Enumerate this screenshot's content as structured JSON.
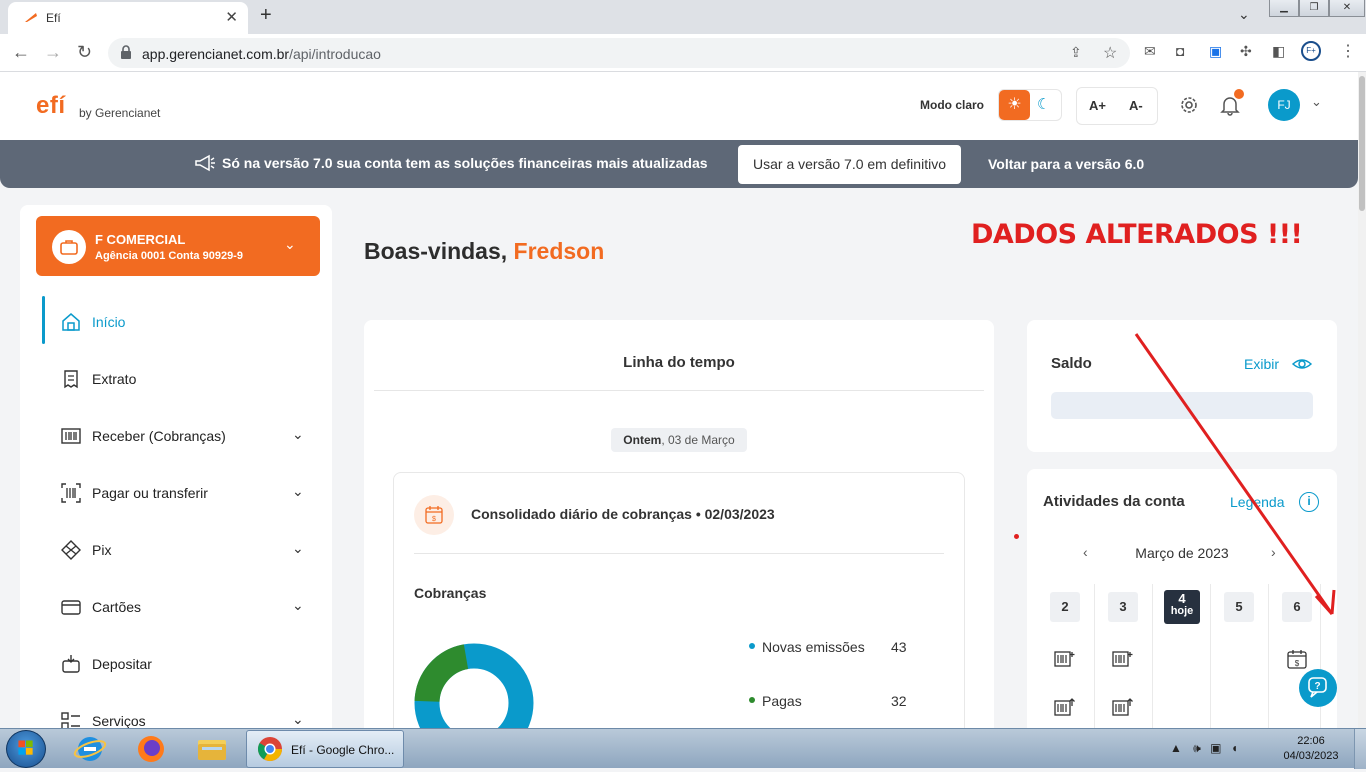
{
  "browser": {
    "tab_title": "Efí",
    "new_tab": "+",
    "url_domain": "app.gerencianet.com.br",
    "url_path": "/api/introducao"
  },
  "header": {
    "logo": "efí",
    "logo_sub": "by Gerencianet",
    "mode_label": "Modo claro",
    "font_increase": "A+",
    "font_decrease": "A-",
    "avatar_initials": "FJ"
  },
  "banner": {
    "text": "Só na versão 7.0 sua conta tem as soluções financeiras mais atualizadas",
    "primary_button": "Usar a versão 7.0 em definitivo",
    "secondary_link": "Voltar para a versão 6.0"
  },
  "account": {
    "name": "F COMERCIAL",
    "details": "Agência 0001  Conta 90929-9"
  },
  "sidebar": {
    "items": [
      {
        "label": "Início",
        "active": true
      },
      {
        "label": "Extrato"
      },
      {
        "label": "Receber (Cobranças)"
      },
      {
        "label": "Pagar ou transferir"
      },
      {
        "label": "Pix"
      },
      {
        "label": "Cartões"
      },
      {
        "label": "Depositar"
      },
      {
        "label": "Serviços"
      }
    ]
  },
  "main": {
    "welcome_prefix": "Boas-vindas, ",
    "welcome_name": "Fredson",
    "annotation": "DADOS ALTERADOS !!!",
    "timeline": {
      "title": "Linha do tempo",
      "date_bold": "Ontem",
      "date_rest": ", 03 de Março",
      "card_title": "Consolidado diário de cobranças • 02/03/2023",
      "section": "Cobranças",
      "legend": [
        {
          "label": "Novas emissões",
          "value": "43",
          "color": "#0a9acb"
        },
        {
          "label": "Pagas",
          "value": "32",
          "color": "#2e8b2e"
        }
      ]
    },
    "saldo": {
      "title": "Saldo",
      "link": "Exibir"
    },
    "atividades": {
      "title": "Atividades da conta",
      "link": "Legenda",
      "info": "i",
      "month": "Março de 2023",
      "days": [
        "2",
        "3",
        "4",
        "5",
        "6"
      ],
      "today_label": "hoje"
    }
  },
  "taskbar": {
    "chrome_label": "Efí - Google Chro...",
    "time": "22:06",
    "date": "04/03/2023"
  },
  "colors": {
    "brand_orange": "#f26b21",
    "brand_blue": "#0a9acb",
    "banner_gray": "#5e6877",
    "annotation_red": "#e02020"
  }
}
